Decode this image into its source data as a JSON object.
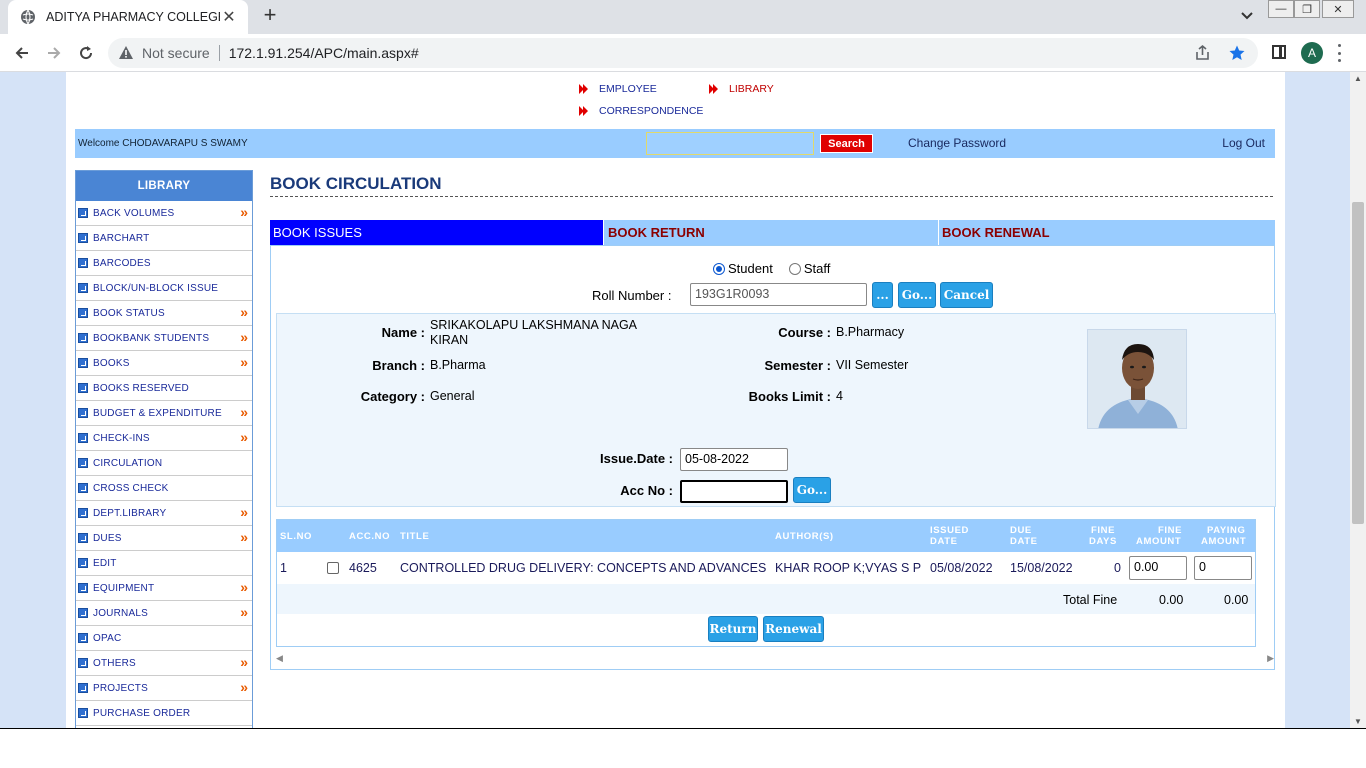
{
  "browser": {
    "tab_title": "ADITYA PHARMACY COLLEGE",
    "security_label": "Not secure",
    "url": "172.1.91.254/APC/main.aspx#",
    "profile_initial": "A"
  },
  "top_menu": {
    "items": [
      {
        "label": "EMPLOYEE",
        "active": false
      },
      {
        "label": "LIBRARY",
        "active": true
      },
      {
        "label": "CORRESPONDENCE",
        "active": false
      }
    ]
  },
  "header": {
    "welcome": "Welcome CHODAVARAPU S SWAMY",
    "search_value": "",
    "search_label": "Search",
    "change_password": "Change Password",
    "logout": "Log Out"
  },
  "sidebar": {
    "title": "LIBRARY",
    "more_glyph": "»",
    "items": [
      {
        "label": "BACK VOLUMES",
        "has_sub": true
      },
      {
        "label": "BARCHART",
        "has_sub": false
      },
      {
        "label": "BARCODES",
        "has_sub": false
      },
      {
        "label": "BLOCK/UN-BLOCK ISSUE",
        "has_sub": false
      },
      {
        "label": "BOOK STATUS",
        "has_sub": true
      },
      {
        "label": "BOOKBANK STUDENTS",
        "has_sub": true
      },
      {
        "label": "BOOKS",
        "has_sub": true
      },
      {
        "label": "BOOKS RESERVED",
        "has_sub": false
      },
      {
        "label": "BUDGET & EXPENDITURE",
        "has_sub": true
      },
      {
        "label": "CHECK-INS",
        "has_sub": true
      },
      {
        "label": "CIRCULATION",
        "has_sub": false
      },
      {
        "label": "CROSS CHECK",
        "has_sub": false
      },
      {
        "label": "DEPT.LIBRARY",
        "has_sub": true
      },
      {
        "label": "DUES",
        "has_sub": true
      },
      {
        "label": "EDIT",
        "has_sub": false
      },
      {
        "label": "EQUIPMENT",
        "has_sub": true
      },
      {
        "label": "JOURNALS",
        "has_sub": true
      },
      {
        "label": "OPAC",
        "has_sub": false
      },
      {
        "label": "OTHERS",
        "has_sub": true
      },
      {
        "label": "PROJECTS",
        "has_sub": true
      },
      {
        "label": "PURCHASE ORDER",
        "has_sub": false
      }
    ]
  },
  "main": {
    "title": "BOOK CIRCULATION",
    "tabs": [
      {
        "label": "BOOK ISSUES",
        "active": true
      },
      {
        "label": "BOOK RETURN",
        "active": false
      },
      {
        "label": "BOOK RENEWAL",
        "active": false
      }
    ],
    "member_type": {
      "student": "Student",
      "staff": "Staff",
      "selected": "Student"
    },
    "roll_label": "Roll Number :",
    "roll_value": "193G1R0093",
    "browse_label": "...",
    "go_label": "Go...",
    "cancel_label": "Cancel",
    "info": {
      "name_label": "Name :",
      "name_value": "SRIKAKOLAPU LAKSHMANA NAGA KIRAN",
      "course_label": "Course :",
      "course_value": "B.Pharmacy",
      "branch_label": "Branch :",
      "branch_value": "B.Pharma",
      "semester_label": "Semester :",
      "semester_value": "VII Semester",
      "category_label": "Category :",
      "category_value": "General",
      "limit_label": "Books Limit :",
      "limit_value": "4"
    },
    "issue_date_label": "Issue.Date :",
    "issue_date_value": "05-08-2022",
    "acc_label": "Acc No :",
    "acc_value": "",
    "acc_go_label": "Go...",
    "grid": {
      "headers": {
        "slno": "SL.NO",
        "accno": "ACC.NO",
        "title": "TITLE",
        "author": "AUTHOR(S)",
        "issued_1": "ISSUED",
        "issued_2": "DATE",
        "due_1": "DUE",
        "due_2": "DATE",
        "finedays_1": "FINE",
        "finedays_2": "DAYS",
        "fineamt_1": "FINE",
        "fineamt_2": "AMOUNT",
        "paying_1": "PAYING",
        "paying_2": "AMOUNT"
      },
      "rows": [
        {
          "slno": "1",
          "checked": false,
          "accno": "4625",
          "title": "CONTROLLED DRUG DELIVERY: CONCEPTS AND ADVANCES",
          "author": "KHAR ROOP K;VYAS S P",
          "issued": "05/08/2022",
          "due": "15/08/2022",
          "fine_days": "0",
          "fine_amount": "0.00",
          "paying_amount": "0"
        }
      ],
      "total_label": "Total Fine",
      "total_fine": "0.00",
      "total_paying": "0.00",
      "return_label": "Return",
      "renewal_label": "Renewal"
    }
  }
}
